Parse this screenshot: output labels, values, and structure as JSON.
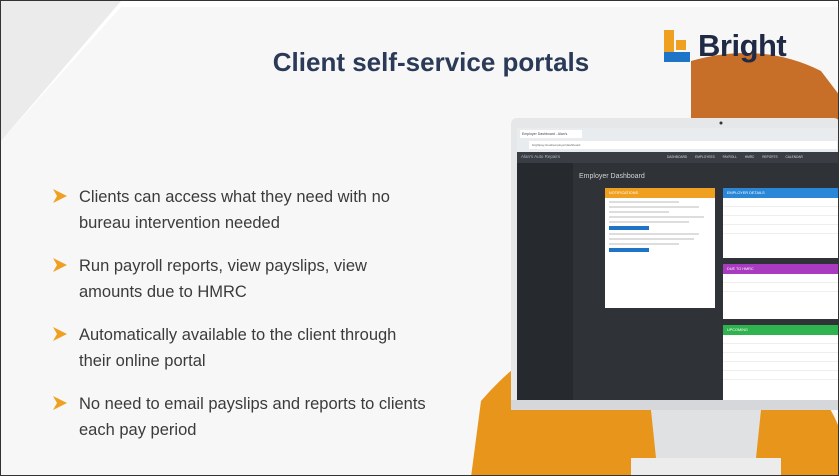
{
  "slide": {
    "title": "Client self-service portals",
    "logo_text": "Bright",
    "colors": {
      "accent_orange": "#f0a020",
      "accent_brown": "#c4661d",
      "title": "#2b3a57"
    }
  },
  "bullets": [
    "Clients can access what they need with no bureau intervention needed",
    "Run payroll reports, view payslips, view amounts due to HMRC",
    "Automatically available to the client through their online portal",
    "No need to email payslips and reports to clients each pay period"
  ],
  "portal": {
    "tab_label": "Employer Dashboard - Alan's",
    "url": "brightpay.cloud/employer/dashboard",
    "app_name": "Alan's Auto Repairs",
    "nav": [
      "DASHBOARD",
      "EMPLOYEES",
      "PAYROLL",
      "HMRC",
      "REPORTS",
      "CALENDAR"
    ],
    "dashboard_title": "Employer Dashboard",
    "cards": {
      "notifications": "NOTIFICATIONS",
      "employer_details": "EMPLOYER DETAILS",
      "due_to_hmrc": "DUE TO HMRC",
      "upcoming": "UPCOMING"
    }
  }
}
